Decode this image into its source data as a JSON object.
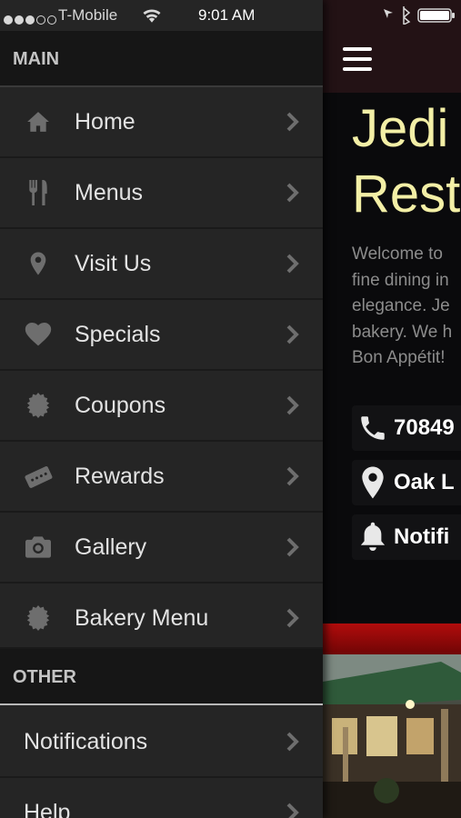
{
  "status_bar": {
    "carrier": "T-Mobile",
    "time": "9:01 AM"
  },
  "drawer": {
    "main_header": "MAIN",
    "main_items": [
      {
        "label": "Home",
        "icon": "home-icon"
      },
      {
        "label": "Menus",
        "icon": "fork-knife-icon"
      },
      {
        "label": "Visit Us",
        "icon": "location-pin-icon"
      },
      {
        "label": "Specials",
        "icon": "heart-icon"
      },
      {
        "label": "Coupons",
        "icon": "badge-icon"
      },
      {
        "label": "Rewards",
        "icon": "ticket-icon"
      },
      {
        "label": "Gallery",
        "icon": "camera-icon"
      },
      {
        "label": "Bakery Menu",
        "icon": "badge-icon"
      }
    ],
    "other_header": "OTHER",
    "other_items": [
      {
        "label": "Notifications"
      },
      {
        "label": "Help"
      }
    ]
  },
  "main": {
    "title": "Jedi\nRest",
    "welcome": "Welcome to\nfine dining in\nelegance. Je\nbakery. We h\nBon Appétit!",
    "info_rows": [
      {
        "icon": "phone-icon",
        "text": "70849"
      },
      {
        "icon": "location-pin-icon",
        "text": "Oak L"
      },
      {
        "icon": "bell-icon",
        "text": "Notifi"
      }
    ]
  },
  "colors": {
    "drawer_bg": "#252525",
    "section_header_bg": "#161616",
    "title_color": "#f3efa6",
    "accent_red": "#b10c0c"
  }
}
